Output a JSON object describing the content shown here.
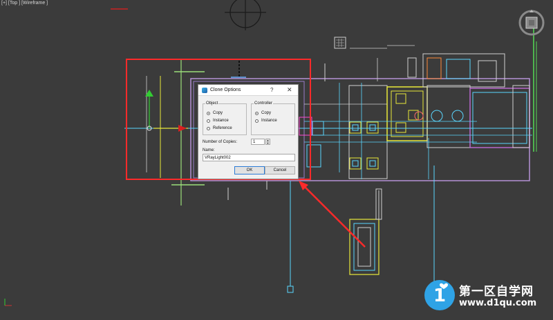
{
  "viewport": {
    "label": "[+] [Top ] [Wireframe ]",
    "background": "#3b3b3b",
    "selection_highlight_color": "#ff2a2a"
  },
  "clone_dialog": {
    "title": "Clone Options",
    "help_label": "?",
    "close_label": "✕",
    "object_group": {
      "legend": "Object",
      "options": [
        {
          "label": "Copy",
          "checked": true
        },
        {
          "label": "Instance",
          "checked": false
        },
        {
          "label": "Reference",
          "checked": false
        }
      ]
    },
    "controller_group": {
      "legend": "Controller",
      "options": [
        {
          "label": "Copy",
          "checked": true
        },
        {
          "label": "Instance",
          "checked": false
        }
      ]
    },
    "copies_label": "Number of Copies:",
    "copies_value": "1",
    "name_label": "Name:",
    "name_value": "VRayLight002",
    "ok_label": "OK",
    "cancel_label": "Cancel"
  },
  "watermark": {
    "brand": "第一区自学网",
    "url": "www.d1qu.com",
    "logo_glyph": "1"
  }
}
